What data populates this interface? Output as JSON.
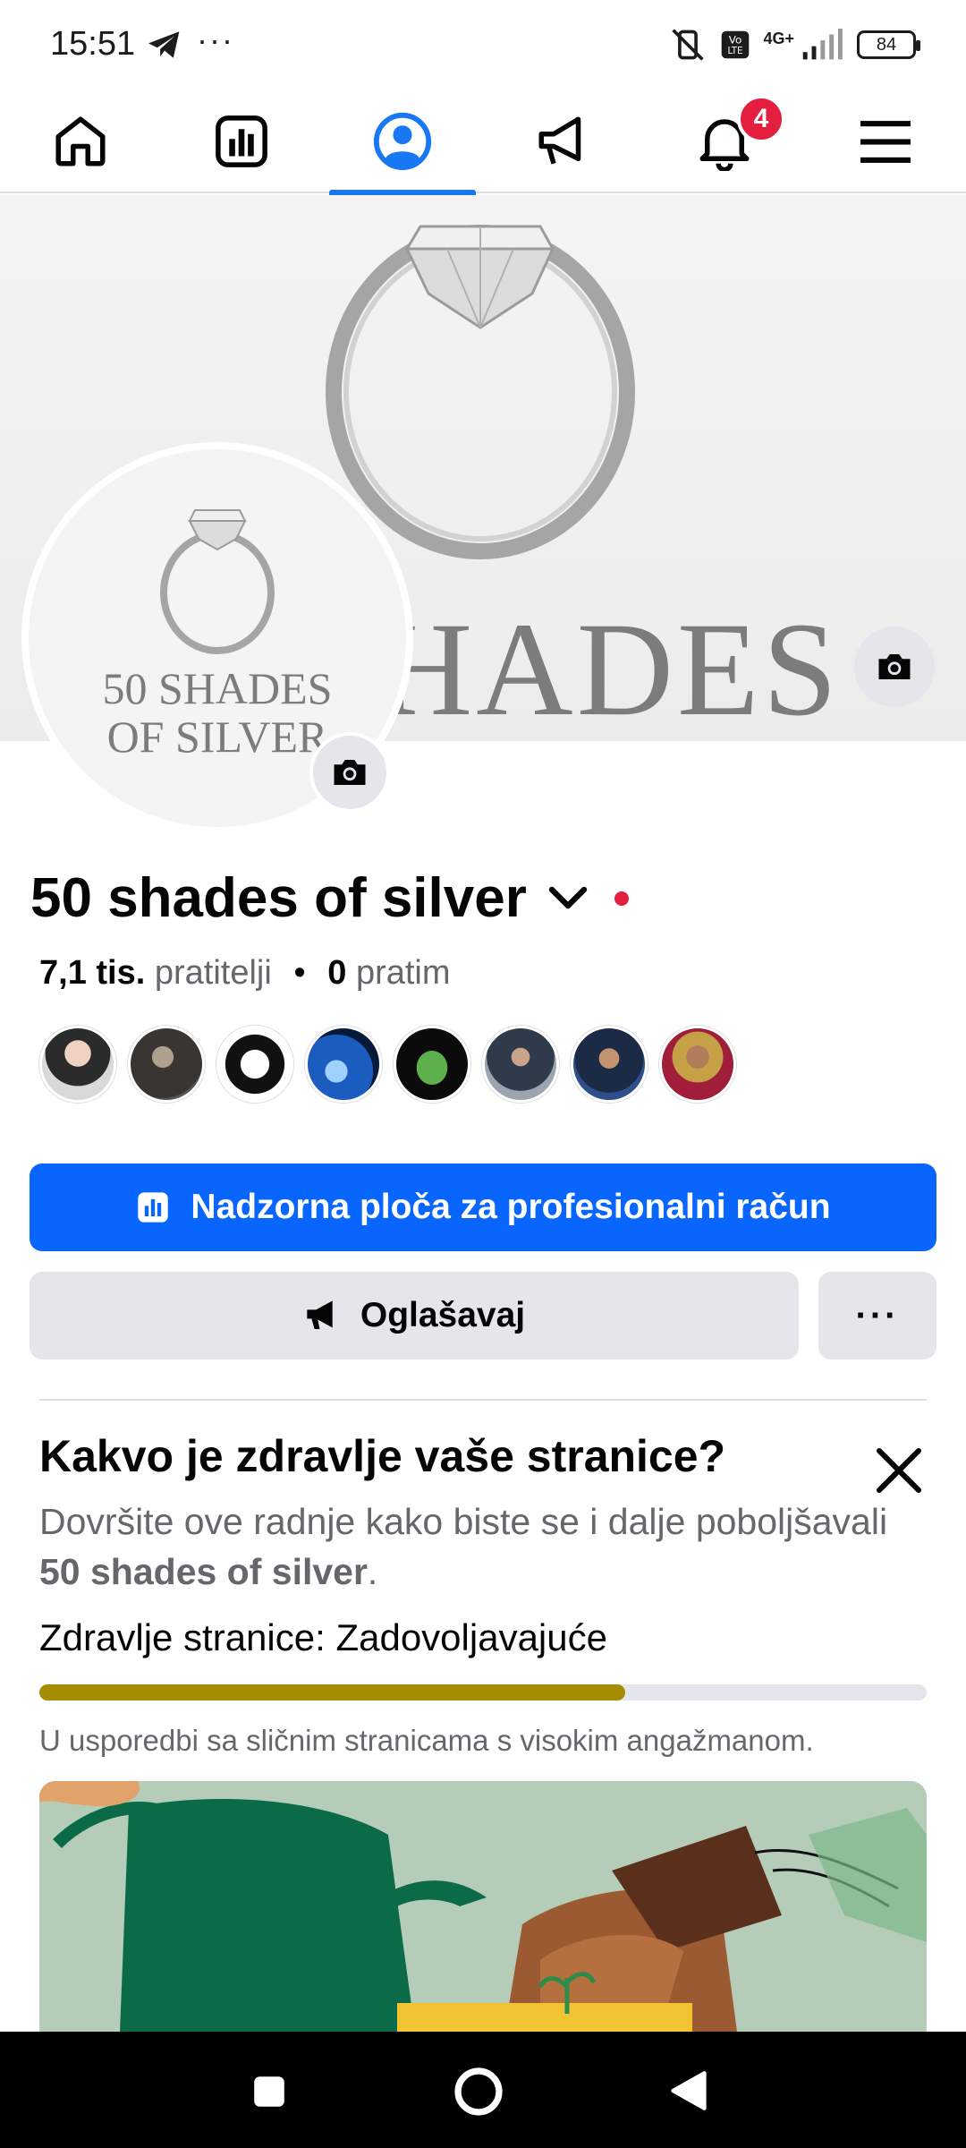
{
  "status_bar": {
    "time": "15:51",
    "battery": "84",
    "network": "4G+"
  },
  "topnav": {
    "items": [
      {
        "name": "home",
        "icon": "home-icon"
      },
      {
        "name": "dashboard",
        "icon": "chart-icon"
      },
      {
        "name": "profile",
        "icon": "profile-icon",
        "active": true
      },
      {
        "name": "ads",
        "icon": "megaphone-icon"
      },
      {
        "name": "notifications",
        "icon": "bell-icon",
        "badge": "4"
      },
      {
        "name": "menu",
        "icon": "hamburger-icon"
      }
    ]
  },
  "cover": {
    "word": "HADES"
  },
  "avatar": {
    "line1": "50 SHADES",
    "line2": "OF SILVER"
  },
  "page": {
    "name": "50 shades of silver",
    "followers_count": "7,1 tis.",
    "followers_label": "pratitelji",
    "separator": "•",
    "following_count": "0",
    "following_label": "pratim"
  },
  "buttons": {
    "dashboard": "Nadzorna ploča za profesionalni račun",
    "advertise": "Oglašavaj",
    "more": "···"
  },
  "health": {
    "title": "Kakvo je zdravlje vaše stranice?",
    "desc_prefix": "Dovršite ove radnje kako biste se i dalje poboljšavali ",
    "desc_page": "50 shades of silver",
    "desc_suffix": ".",
    "status_label": "Zdravlje stranice:",
    "status_value": "Zadovoljavajuće",
    "progress": 0.66,
    "note": "U usporedbi sa sličnim stranicama s visokim angažmanom."
  },
  "colors": {
    "accent": "#0866ff",
    "badge": "#e41e3f",
    "progress": "#a68c00"
  }
}
